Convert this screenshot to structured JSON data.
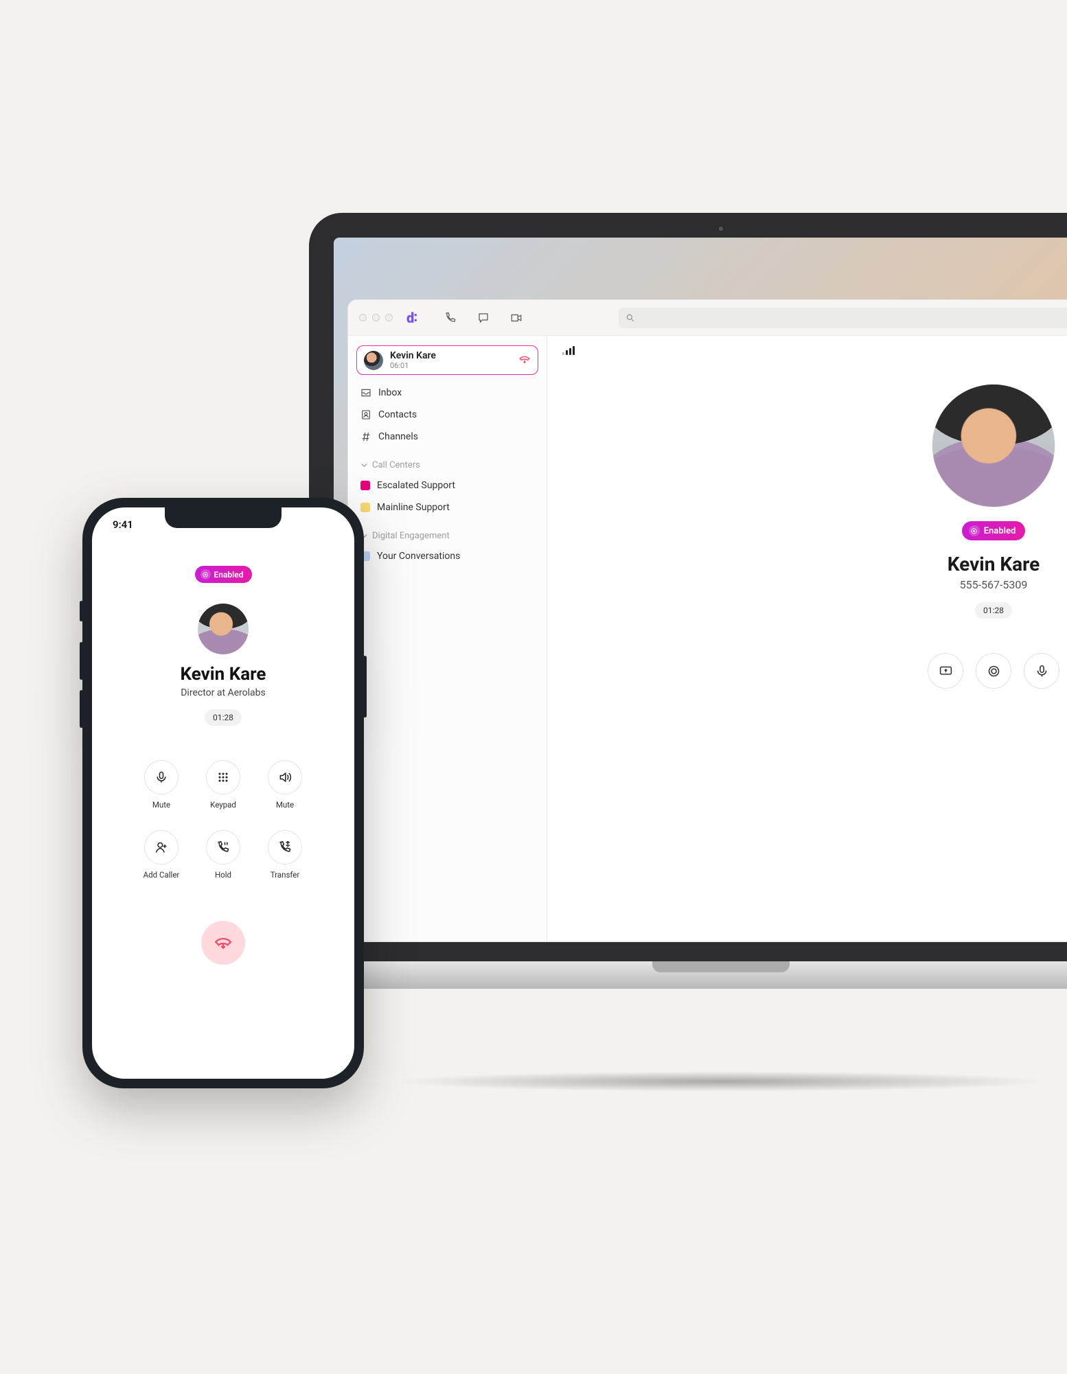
{
  "phone": {
    "status_time": "9:41",
    "ai_badge": "Enabled",
    "caller_name": "Kevin Kare",
    "caller_title": "Director at Aerolabs",
    "call_duration": "01:28",
    "actions": {
      "mute": "Mute",
      "keypad": "Keypad",
      "speaker": "Mute",
      "add_caller": "Add Caller",
      "hold": "Hold",
      "transfer": "Transfer"
    }
  },
  "desktop": {
    "search_placeholder": "",
    "sidebar": {
      "active_call": {
        "name": "Kevin Kare",
        "duration": "06:01"
      },
      "nav": {
        "inbox": "Inbox",
        "contacts": "Contacts",
        "channels": "Channels"
      },
      "sections": {
        "call_centers": {
          "label": "Call Centers",
          "items": {
            "escalated": {
              "label": "Escalated Support",
              "color": "#e6007e"
            },
            "mainline": {
              "label": "Mainline Support",
              "color": "#f7d774"
            }
          }
        },
        "digital_engagement": {
          "label": "Digital Engagement",
          "items": {
            "your_convos": {
              "label": "Your Conversations",
              "color": "#bed3f5"
            }
          }
        }
      }
    },
    "main": {
      "ai_badge": "Enabled",
      "caller_name": "Kevin Kare",
      "caller_number": "555-567-5309",
      "call_duration": "01:28"
    }
  }
}
